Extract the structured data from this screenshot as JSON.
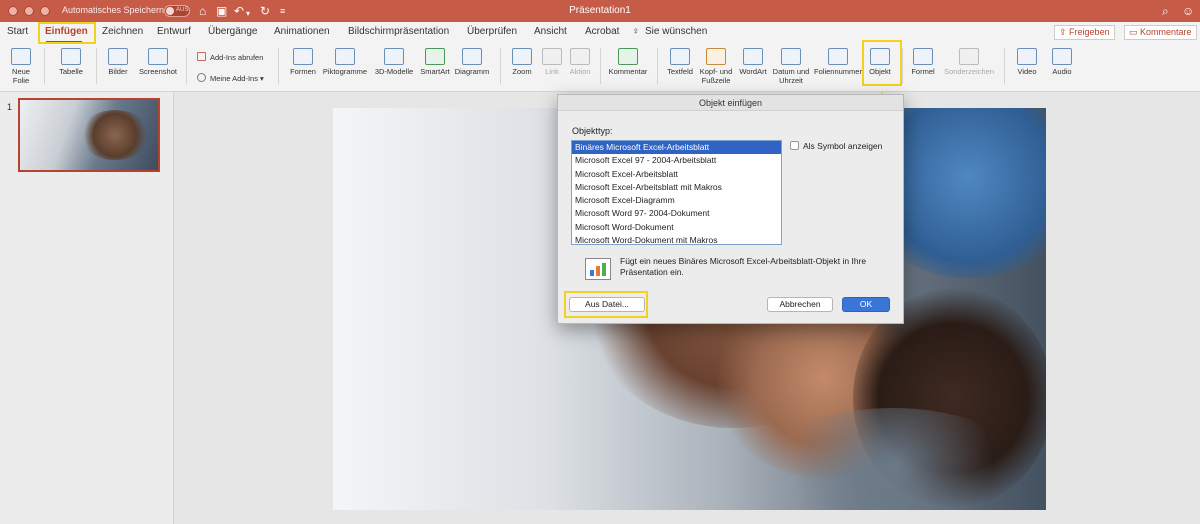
{
  "titlebar": {
    "autosave_label": "Automatisches Speichern",
    "autosave_state": "AUS",
    "document_title": "Präsentation1"
  },
  "tabs": [
    "Start",
    "Einfügen",
    "Zeichnen",
    "Entwurf",
    "Übergänge",
    "Animationen",
    "Bildschirmpräsentation",
    "Überprüfen",
    "Ansicht",
    "Acrobat",
    "Sie wünschen"
  ],
  "active_tab": "Einfügen",
  "share": {
    "share_label": "Freigeben",
    "comments_label": "Kommentare"
  },
  "ribbon": {
    "new_slide": "Neue\nFolie",
    "table": "Tabelle",
    "pictures": "Bilder",
    "screenshot": "Screenshot",
    "get_addins": "Add-Ins abrufen",
    "my_addins": "Meine Add-Ins",
    "shapes": "Formen",
    "icons": "Piktogramme",
    "models_3d": "3D-Modelle",
    "smartart": "SmartArt",
    "chart": "Diagramm",
    "zoom": "Zoom",
    "link": "Link",
    "action": "Aktion",
    "comment": "Kommentar",
    "textbox": "Textfeld",
    "header_footer": "Kopf- und\nFußzeile",
    "wordart": "WordArt",
    "date_time": "Datum und\nUhrzeit",
    "slide_number": "Foliennummer",
    "object": "Objekt",
    "equation": "Formel",
    "symbol": "Sonderzeichen",
    "video": "Video",
    "audio": "Audio"
  },
  "slides_pane": {
    "slide_number": "1"
  },
  "dialog": {
    "title": "Objekt einfügen",
    "list_label": "Objekttyp:",
    "items": [
      "Binäres Microsoft Excel-Arbeitsblatt",
      "Microsoft Excel 97 - 2004-Arbeitsblatt",
      "Microsoft Excel-Arbeitsblatt",
      "Microsoft Excel-Arbeitsblatt mit Makros",
      "Microsoft Excel-Diagramm",
      "Microsoft Word 97- 2004-Dokument",
      "Microsoft Word-Dokument",
      "Microsoft Word-Dokument mit Makros"
    ],
    "selected_index": 0,
    "show_as_icon_label": "Als Symbol anzeigen",
    "show_as_icon_checked": false,
    "description": "Fügt ein neues Binäres Microsoft Excel-Arbeitsblatt-Objekt in Ihre Präsentation ein.",
    "from_file_button": "Aus Datei...",
    "cancel_button": "Abbrechen",
    "ok_button": "OK"
  },
  "colors": {
    "brand": "#c65b48",
    "highlight": "#f2d21a",
    "selection": "#2f63c4",
    "primary_button": "#3a76d8"
  }
}
